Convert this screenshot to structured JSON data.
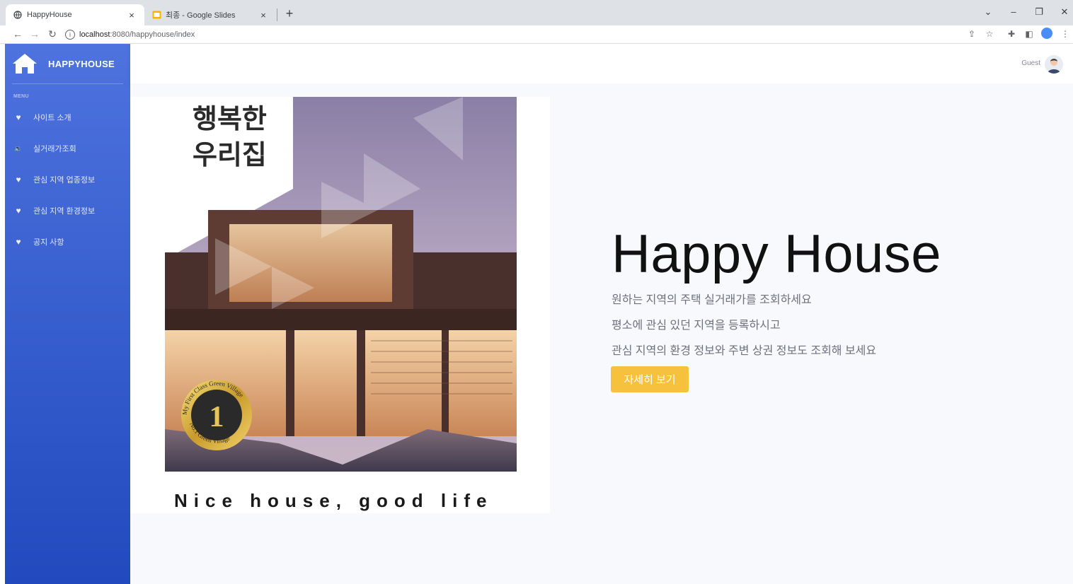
{
  "browser": {
    "tabs": [
      {
        "title": "HappyHouse",
        "close": "×"
      },
      {
        "title": "최종 - Google Slides",
        "close": "×"
      }
    ],
    "new_tab": "+",
    "window_controls": {
      "minimize": "–",
      "restore": "❐",
      "close": "✕",
      "tab_search": "⌄"
    },
    "url_host": "localhost",
    "url_rest": ":8080/happyhouse/index"
  },
  "app": {
    "brand": "HAPPYHOUSE",
    "menu_heading": "MENU",
    "nav": [
      {
        "label": "사이트 소개",
        "icon": "heart-icon",
        "glyph": "♥"
      },
      {
        "label": "실거래가조회",
        "icon": "volume-icon",
        "glyph": "🔉"
      },
      {
        "label": "관심 지역 업종정보",
        "icon": "heart-icon",
        "glyph": "♥"
      },
      {
        "label": "관심 지역 환경정보",
        "icon": "heart-icon",
        "glyph": "♥"
      },
      {
        "label": "공지 사항",
        "icon": "heart-icon",
        "glyph": "♥"
      }
    ],
    "user_label": "Guest",
    "hero": {
      "image_title_line1": "행복한",
      "image_title_line2": "우리집",
      "badge_top": "My First Class Green Village",
      "badge_number": "1",
      "badge_bottom": "No.1 Green Village",
      "slogan": "Nice house, good life",
      "title": "Happy House",
      "lines": [
        "원하는 지역의 주택 실거래가를 조회하세요",
        "평소에 관심 있던 지역을 등록하시고",
        "관심 지역의 환경 정보와 주변 상권 정보도 조회해 보세요"
      ],
      "button": "자세히 보기"
    }
  },
  "colors": {
    "sidebar_top": "#4e73df",
    "sidebar_bottom": "#224abe",
    "button": "#f6c23e",
    "content_bg": "#f8f9fc"
  }
}
